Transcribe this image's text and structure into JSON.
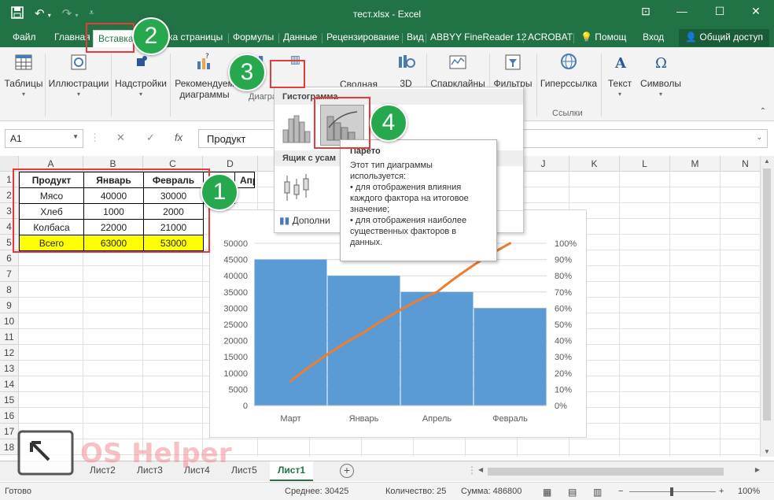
{
  "window": {
    "title": "тест.xlsx - Excel",
    "minimize_label": "—",
    "restore_label": "❐",
    "maximize_label": "☐",
    "close_label": "✕"
  },
  "tabs": [
    {
      "label": "Файл"
    },
    {
      "label": "Главная"
    },
    {
      "label": "Вставка"
    },
    {
      "label": "ка страницы"
    },
    {
      "label": "Формулы"
    },
    {
      "label": "Данные"
    },
    {
      "label": "Рецензирование"
    },
    {
      "label": "Вид"
    },
    {
      "label": "ABBYY FineReader 12"
    },
    {
      "label": "ACROBAT"
    },
    {
      "label": "Помощ"
    },
    {
      "label": "Вход"
    },
    {
      "label": "Общий доступ"
    }
  ],
  "ribbon": {
    "tables": "Таблицы",
    "illustrations": "Иллюстрации",
    "addins": "Надстройки",
    "recommended_charts_1": "Рекомендуем",
    "recommended_charts_2": "диаграммы",
    "charts_group": "Диаграм",
    "pivot_partial": "Сводная",
    "threed_partial": "3D",
    "sparklines": "Спарклайны",
    "filters": "Фильтры",
    "hyperlink": "Гиперссылка",
    "text": "Текст",
    "symbols": "Символы",
    "links_group": "Ссылки"
  },
  "formula_bar": {
    "name_box": "A1",
    "cancel": "✕",
    "enter": "✓",
    "fx": "fx",
    "content": "Продукт"
  },
  "columns": [
    "A",
    "B",
    "C",
    "D",
    "E",
    "F",
    "G",
    "H",
    "I",
    "J",
    "K",
    "L",
    "M",
    "N"
  ],
  "rows": [
    "1",
    "2",
    "3",
    "4",
    "5",
    "6",
    "7",
    "8",
    "9",
    "10",
    "11",
    "12",
    "13",
    "14",
    "15",
    "16",
    "17",
    "18"
  ],
  "table": {
    "headers": [
      "Продукт",
      "Январь",
      "Февраль"
    ],
    "rows": [
      [
        "Мясо",
        "40000",
        "30000"
      ],
      [
        "Хлеб",
        "1000",
        "2000"
      ],
      [
        "Колбаса",
        "22000",
        "21000"
      ],
      [
        "Всего",
        "63000",
        "53000"
      ]
    ],
    "d_header_partial": "рт",
    "d_value_partial": "000",
    "e_header_partial": "Апр"
  },
  "gallery": {
    "section1": "Гистограмма",
    "section2": "Ящик с усам",
    "more": "Дополни"
  },
  "tooltip": {
    "title": "Парето",
    "body1": "Этот тип диаграммы используется:",
    "body2": "• для отображения влияния каждого фактора на итоговое значение;",
    "body3": "• для отображения наиболее существенных факторов в данных."
  },
  "callouts": [
    "1",
    "2",
    "3",
    "4"
  ],
  "chart_data": {
    "type": "bar",
    "categories": [
      "Март",
      "Январь",
      "Апрель",
      "Февраль"
    ],
    "series": [
      {
        "values": [
          45000,
          40000,
          35000,
          30000
        ]
      },
      {
        "values": [
          15,
          45,
          70,
          100
        ]
      }
    ],
    "y_left_ticks": [
      "0",
      "5000",
      "10000",
      "15000",
      "20000",
      "25000",
      "30000",
      "35000",
      "40000",
      "45000",
      "50000"
    ],
    "y_right_ticks": [
      "0%",
      "10%",
      "20%",
      "30%",
      "40%",
      "50%",
      "60%",
      "70%",
      "80%",
      "90%",
      "100%"
    ],
    "ylim": [
      0,
      50000
    ],
    "y2lim": [
      0,
      100
    ],
    "bar_color": "#5b9bd5",
    "line_color": "#ed7d31",
    "grid": true
  },
  "sheets": [
    "Лист2",
    "Лист3",
    "Лист4",
    "Лист5",
    "Лист1"
  ],
  "add_sheet": "⊕",
  "status": {
    "ready": "Готово",
    "average": "Среднее: 30425",
    "count": "Количество: 25",
    "sum": "Сумма: 486800",
    "zoom": "100%"
  },
  "watermark": "OS Helper",
  "colors": {
    "excel_green": "#217346",
    "callout_green": "#26a84d",
    "callout_red": "#e53b3b",
    "total_row": "#ffff00"
  }
}
